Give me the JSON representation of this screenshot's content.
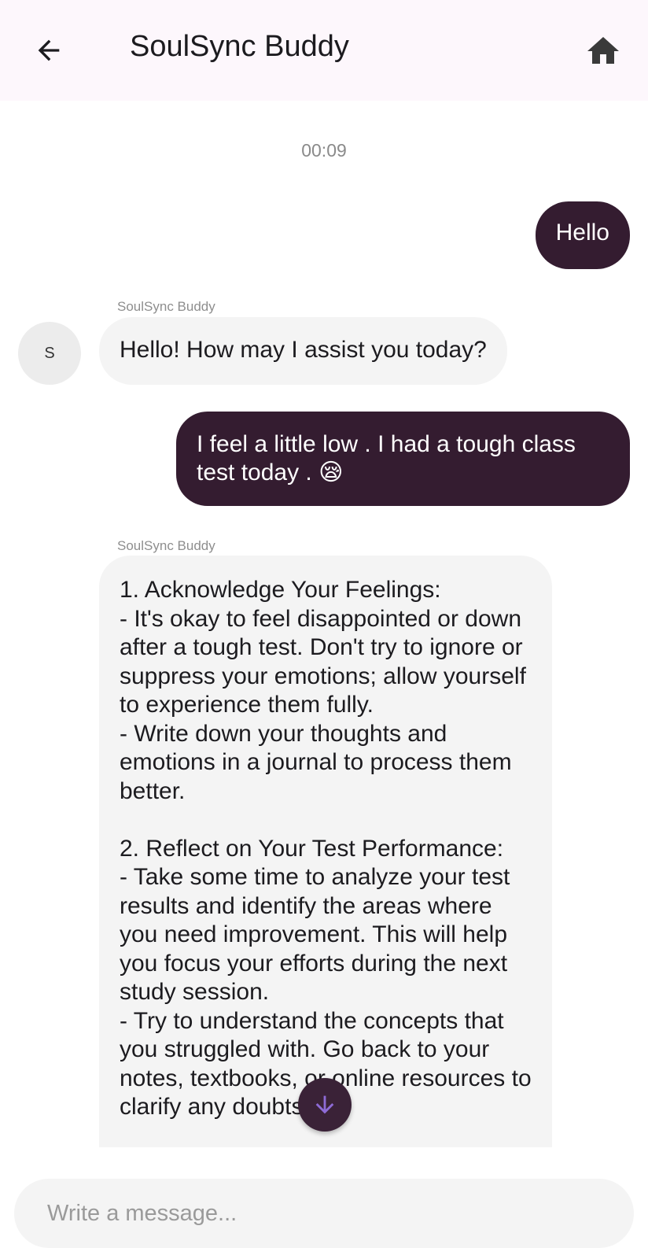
{
  "header": {
    "title": "SoulSync Buddy",
    "back_icon": "arrow-back-icon",
    "home_icon": "home-icon"
  },
  "chat": {
    "timestamp": "00:09",
    "messages": [
      {
        "role": "user",
        "text": "Hello"
      },
      {
        "role": "bot",
        "sender": "SoulSync Buddy",
        "avatar_letter": "S",
        "text": "Hello! How may I assist you today?"
      },
      {
        "role": "user",
        "text": "I feel a little low . I had a tough class test today . 😪"
      },
      {
        "role": "bot",
        "sender": "SoulSync Buddy",
        "text": "1. Acknowledge Your Feelings:\n- It's okay to feel disappointed or down after a tough test. Don't try to ignore or suppress your emotions; allow yourself to experience them fully.\n- Write down your thoughts and emotions in a journal to process them better.\n\n2. Reflect on Your Test Performance:\n- Take some time to analyze your test results and identify the areas where you need improvement. This will help you focus your efforts during the next study session.\n- Try to understand the concepts that you struggled with. Go back to your notes, textbooks, or online resources to clarify any doubts."
      }
    ]
  },
  "scroll_button": {
    "icon": "arrow-down-icon"
  },
  "composer": {
    "placeholder": "Write a message..."
  },
  "colors": {
    "appbar_bg": "#fdf7fc",
    "user_bubble": "#341c30",
    "bot_bubble": "#f4f4f4",
    "fab": "#3a2237",
    "fab_icon": "#8e6bd6"
  }
}
